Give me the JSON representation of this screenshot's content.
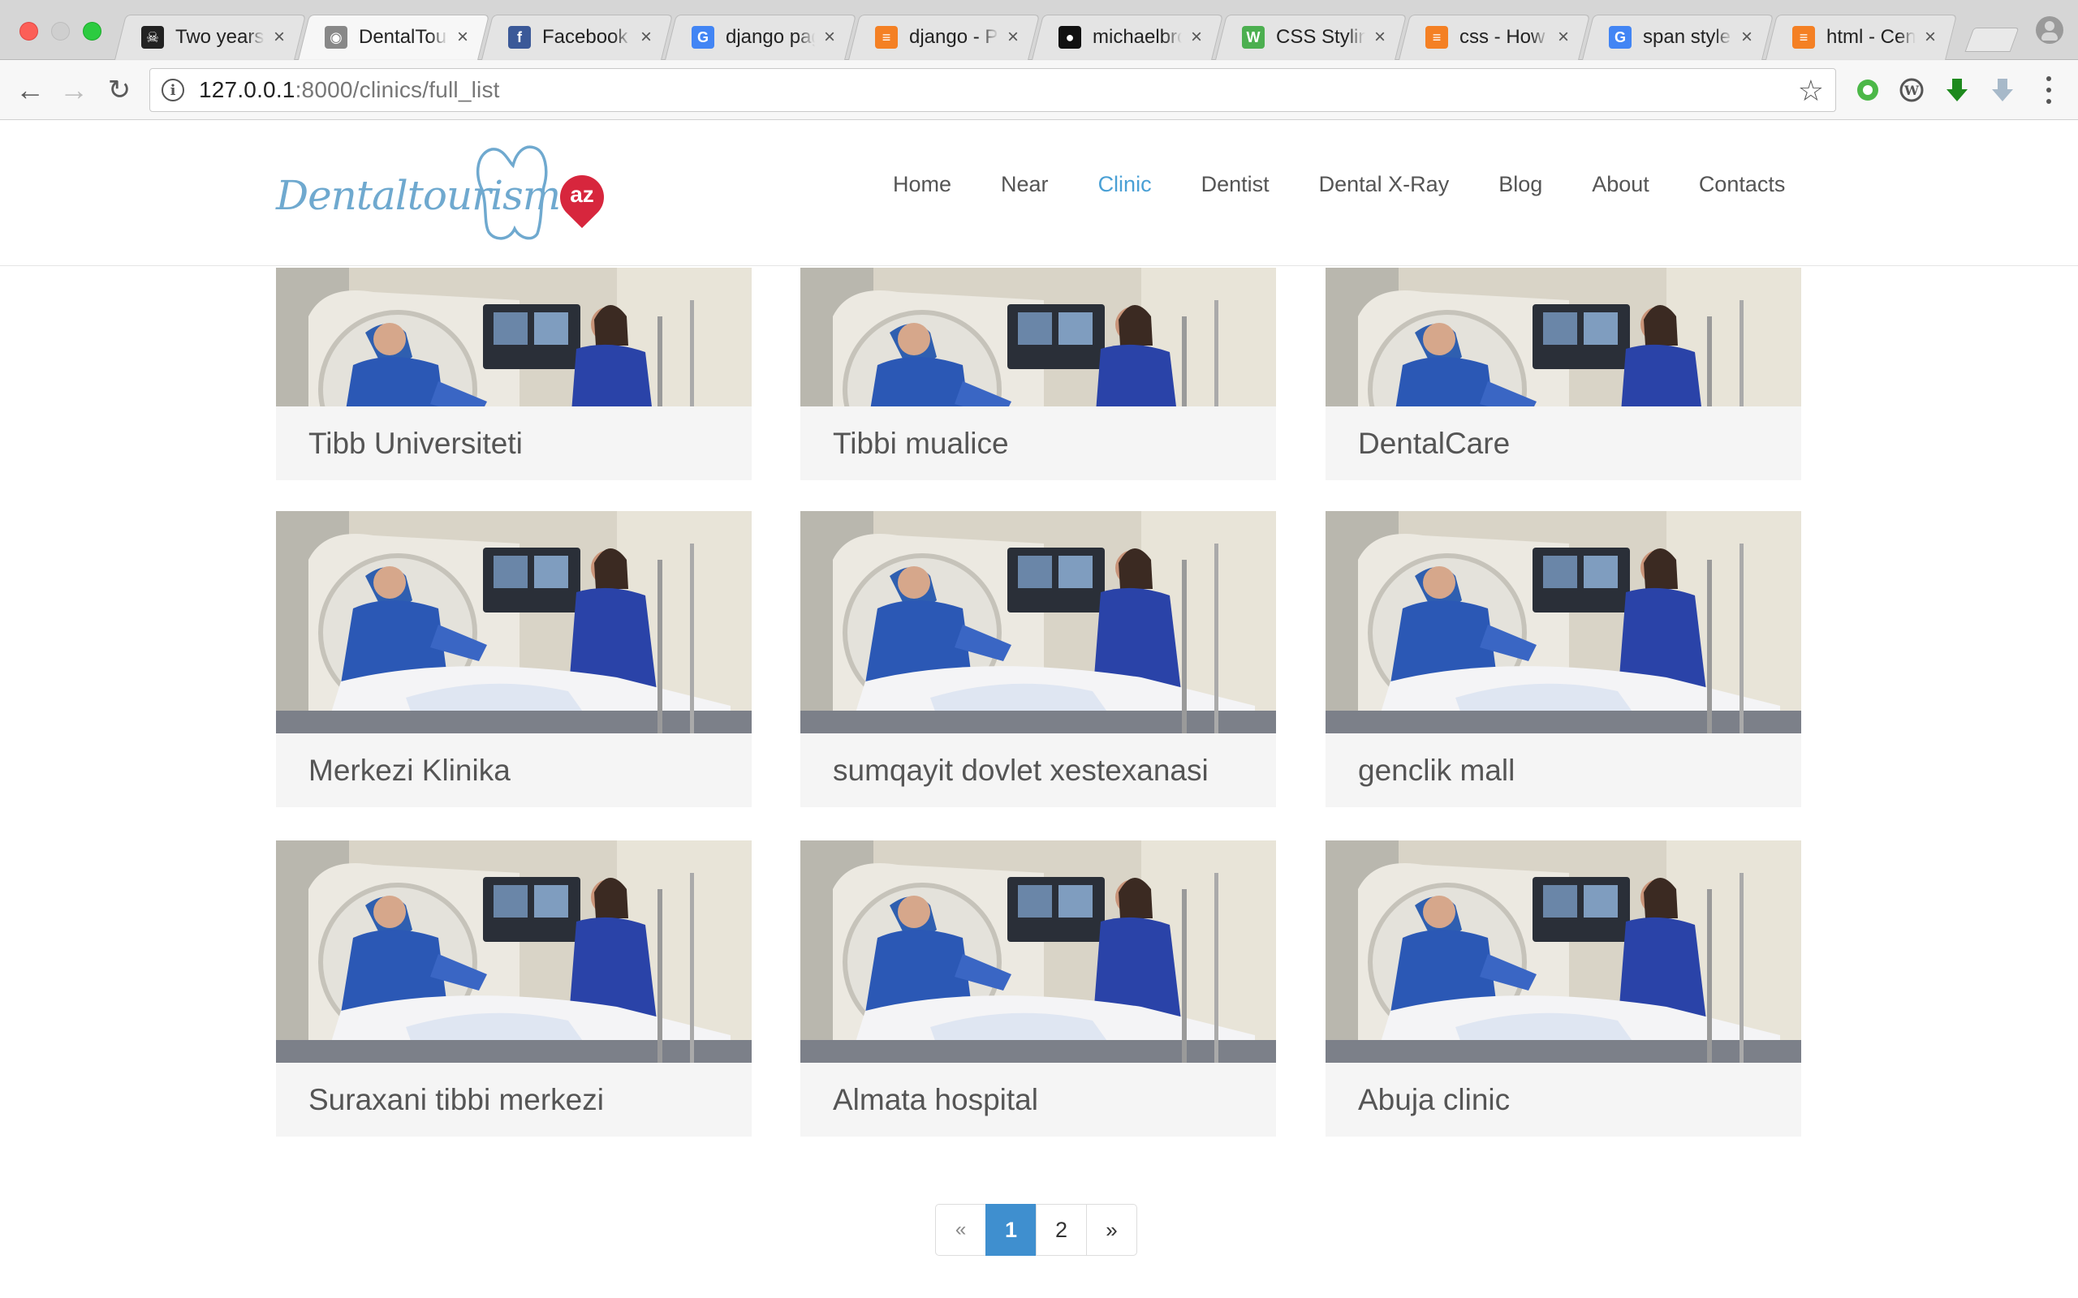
{
  "browser": {
    "tabs": [
      {
        "title": "Two years",
        "icon": "skull-icon",
        "color": "#222222",
        "active": false
      },
      {
        "title": "DentalTourism",
        "icon": "site-icon",
        "color": "#888888",
        "active": true
      },
      {
        "title": "Facebook",
        "icon": "facebook-icon",
        "color": "#3b5998",
        "active": false
      },
      {
        "title": "django pagination",
        "icon": "google-icon",
        "color": "#4285f4",
        "active": false
      },
      {
        "title": "django - Pagination",
        "icon": "stackoverflow-icon",
        "color": "#f48024",
        "active": false
      },
      {
        "title": "michaelbromley",
        "icon": "github-icon",
        "color": "#111111",
        "active": false
      },
      {
        "title": "CSS Styling",
        "icon": "w3-icon",
        "color": "#4caf50",
        "active": false
      },
      {
        "title": "css - How to",
        "icon": "stackoverflow-icon",
        "color": "#f48024",
        "active": false
      },
      {
        "title": "span style",
        "icon": "google-icon",
        "color": "#4285f4",
        "active": false
      },
      {
        "title": "html - Center",
        "icon": "stackoverflow-icon",
        "color": "#f48024",
        "active": false
      }
    ],
    "url_host": "127.0.0.1",
    "url_path": ":8000/clinics/full_list"
  },
  "site": {
    "logo_text": "Dentaltourism",
    "logo_badge": "az",
    "nav": [
      {
        "label": "Home",
        "active": false
      },
      {
        "label": "Near",
        "active": false
      },
      {
        "label": "Clinic",
        "active": true
      },
      {
        "label": "Dentist",
        "active": false
      },
      {
        "label": "Dental X-Ray",
        "active": false
      },
      {
        "label": "Blog",
        "active": false
      },
      {
        "label": "About",
        "active": false
      },
      {
        "label": "Contacts",
        "active": false
      }
    ],
    "accent_color": "#4aa0d5"
  },
  "clinics": [
    {
      "name": "Tibb Universiteti"
    },
    {
      "name": "Tibbi mualice"
    },
    {
      "name": "DentalCare"
    },
    {
      "name": "Merkezi Klinika"
    },
    {
      "name": "sumqayit dovlet xestexanasi"
    },
    {
      "name": "genclik mall"
    },
    {
      "name": "Suraxani tibbi merkezi"
    },
    {
      "name": "Almata hospital"
    },
    {
      "name": "Abuja clinic"
    }
  ],
  "pagination": {
    "prev": "«",
    "pages": [
      "1",
      "2"
    ],
    "current": "1",
    "next": "»"
  }
}
